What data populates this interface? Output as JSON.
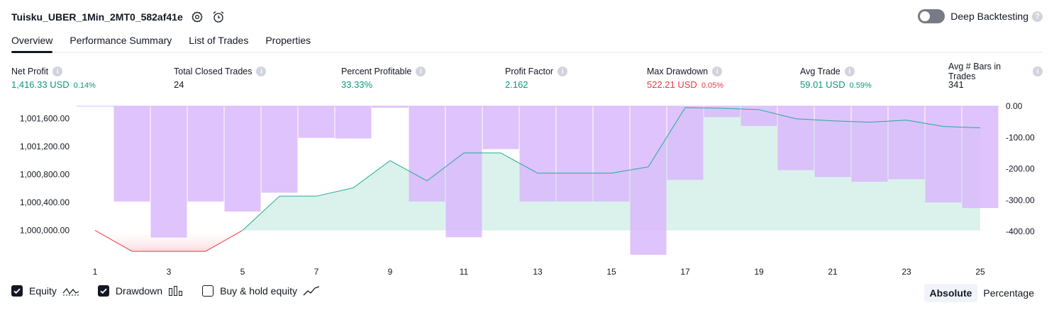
{
  "header": {
    "strategy_name": "Tuisku_UBER_1Min_2MT0_582af41e",
    "settings_icon": "gear-icon",
    "alert_icon": "alarm-clock-plus-icon",
    "deep_backtesting_label": "Deep Backtesting",
    "deep_backtesting_enabled": false
  },
  "tabs": [
    {
      "label": "Overview",
      "active": true
    },
    {
      "label": "Performance Summary",
      "active": false
    },
    {
      "label": "List of Trades",
      "active": false
    },
    {
      "label": "Properties",
      "active": false
    }
  ],
  "metrics": [
    {
      "label": "Net Profit",
      "value": "1,416.33 USD",
      "pct": "0.14%",
      "color": "#089981"
    },
    {
      "label": "Total Closed Trades",
      "value": "24",
      "pct": "",
      "color": "#131722"
    },
    {
      "label": "Percent Profitable",
      "value": "33.33%",
      "pct": "",
      "color": "#089981"
    },
    {
      "label": "Profit Factor",
      "value": "2.162",
      "pct": "",
      "color": "#089981"
    },
    {
      "label": "Max Drawdown",
      "value": "522.21 USD",
      "pct": "0.05%",
      "color": "#f23645"
    },
    {
      "label": "Avg Trade",
      "value": "59.01 USD",
      "pct": "0.59%",
      "color": "#089981"
    },
    {
      "label": "Avg # Bars in Trades",
      "value": "341",
      "pct": "",
      "color": "#131722"
    }
  ],
  "chart_data": {
    "type": "line",
    "x": [
      1,
      2,
      3,
      4,
      5,
      6,
      7,
      8,
      9,
      10,
      11,
      12,
      13,
      14,
      15,
      16,
      17,
      18,
      19,
      20,
      21,
      22,
      23,
      24,
      25
    ],
    "equity": [
      1000000,
      999700,
      999700,
      999700,
      1000000,
      1000490,
      1000490,
      1000610,
      1001000,
      1000710,
      1001110,
      1001110,
      1000820,
      1000820,
      1000820,
      1000910,
      1001760,
      1001750,
      1001730,
      1001600,
      1001570,
      1001550,
      1001580,
      1001490,
      1001470
    ],
    "drawdown": [
      0,
      -304,
      -419,
      -304,
      -336,
      -276,
      -101,
      -103,
      -5,
      -304,
      -418,
      -137,
      -304,
      -304,
      -304,
      -474,
      -235,
      -35,
      -63,
      -204,
      -226,
      -241,
      -233,
      -307,
      -325
    ],
    "left_axis": {
      "ticks": [
        "1,000,000.00",
        "1,000,400.00",
        "1,000,800.00",
        "1,001,200.00",
        "1,001,600.00"
      ],
      "range": [
        999650,
        1001780
      ]
    },
    "right_axis": {
      "ticks": [
        "0.00",
        "-100.00",
        "-200.00",
        "-300.00",
        "-400.00"
      ],
      "range": [
        -474,
        0
      ]
    },
    "x_ticks": [
      "1",
      "3",
      "5",
      "7",
      "9",
      "11",
      "13",
      "15",
      "17",
      "19",
      "21",
      "23",
      "25"
    ],
    "colors": {
      "equity_line": "#22ab94",
      "equity_fill": "#d4f0e8",
      "loss_line": "#f23645",
      "loss_fill": "#fcd9dc",
      "drawdown_bar": "#d9b8fb"
    }
  },
  "legend": [
    {
      "label": "Equity",
      "checked": true,
      "icon": "equity-line-icon"
    },
    {
      "label": "Drawdown",
      "checked": true,
      "icon": "drawdown-bars-icon"
    },
    {
      "label": "Buy & hold equity",
      "checked": false,
      "icon": "buy-hold-line-icon"
    }
  ],
  "modes": [
    {
      "label": "Absolute",
      "active": true
    },
    {
      "label": "Percentage",
      "active": false
    }
  ]
}
